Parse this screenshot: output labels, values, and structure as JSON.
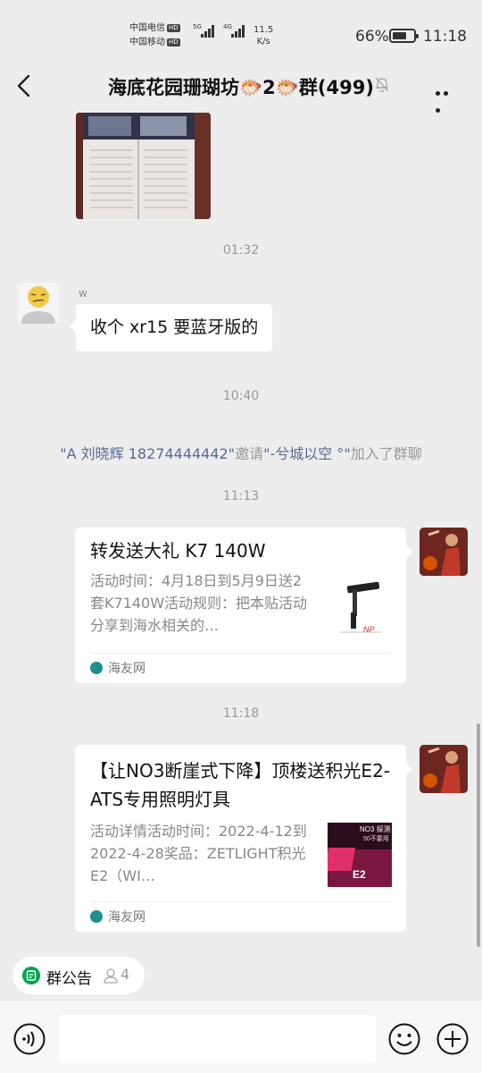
{
  "status_bar": {
    "carrier_1": "中国电信",
    "carrier_2": "中国移动",
    "hd_badge": "HD",
    "network_1": "5G",
    "network_2": "4G",
    "speed_value": "11.5",
    "speed_unit": "K/s",
    "battery_percent": "66%",
    "battery_level": 0.66,
    "time": "11:18"
  },
  "header": {
    "title": "海底花园珊瑚坊🐡2🐡群(499)",
    "back_icon": "chevron-left-icon",
    "mute_icon": "bell-muted-icon",
    "more_icon": "more-dots-icon"
  },
  "messages": {
    "timestamp_1": "01:32",
    "sender_name": "w",
    "text_message": "收个 xr15 要蓝牙版的",
    "timestamp_2": "10:40",
    "system": {
      "inviter": "\"A 刘晓辉 18274444442\"",
      "verb": "邀请",
      "invitee": "\"-兮城以空 °\"",
      "suffix": "加入了群聊"
    },
    "timestamp_3": "11:13",
    "card_1": {
      "title": "转发送大礼 K7 140W",
      "description": "活动时间：4月18日到5月9日送2套K7140W活动规则：把本贴活动分享到海水相关的…",
      "source": "海友网",
      "thumb_brand": "NP"
    },
    "timestamp_4": "11:18",
    "card_2": {
      "title": "【让NO3断崖式下降】顶楼送积光E2-ATS专用照明灯具",
      "description": "活动详情活动时间：2022-4-12到2022-4-28奖品：ZETLIGHT积光E2（WI…",
      "source": "海友网",
      "thumb_line_1": "NO3 探测",
      "thumb_line_2": "50不要用",
      "thumb_model": "E2"
    }
  },
  "group_notice": {
    "label": "群公告",
    "count": "4"
  },
  "input_bar": {
    "voice_icon": "voice-icon",
    "emoji_icon": "emoji-icon",
    "plus_icon": "plus-icon",
    "value": ""
  }
}
